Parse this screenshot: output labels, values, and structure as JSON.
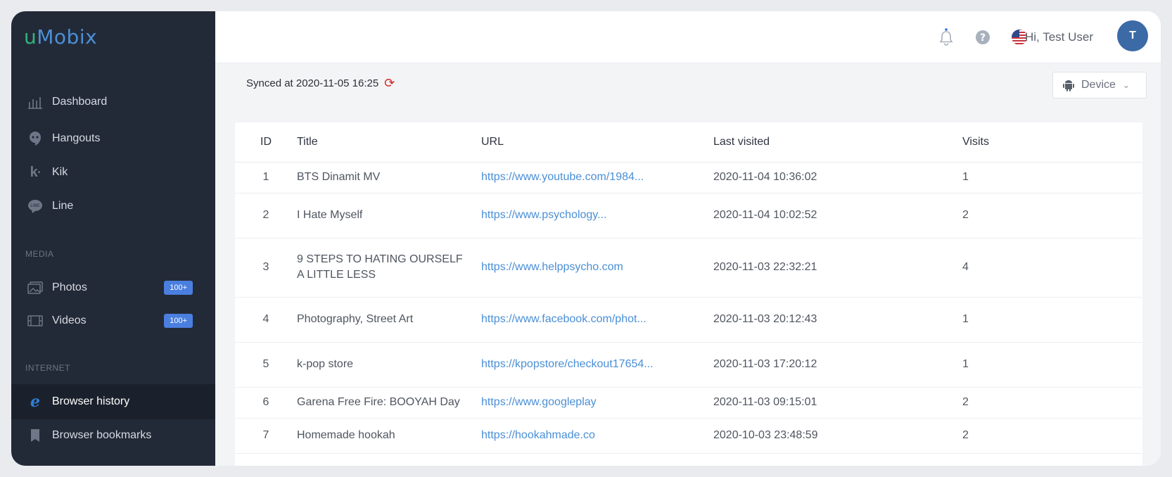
{
  "app": {
    "logo_u": "u",
    "logo_rest": "Mobix"
  },
  "sidebar": {
    "items": [
      {
        "label": "Dashboard",
        "icon": "dashboard-icon"
      },
      {
        "label": "Hangouts",
        "icon": "hangouts-icon"
      },
      {
        "label": "Kik",
        "icon": "kik-icon"
      },
      {
        "label": "Line",
        "icon": "line-icon"
      }
    ],
    "media_label": "MEDIA",
    "media": [
      {
        "label": "Photos",
        "badge": "100+",
        "icon": "photos-icon"
      },
      {
        "label": "Videos",
        "badge": "100+",
        "icon": "videos-icon"
      }
    ],
    "internet_label": "INTERNET",
    "internet": [
      {
        "label": "Browser history",
        "icon": "internet-explorer-icon",
        "active": true
      },
      {
        "label": "Browser bookmarks",
        "icon": "bookmark-icon"
      }
    ]
  },
  "topbar": {
    "greeting": "Hi, Test User",
    "avatar_initial": "T"
  },
  "sync": {
    "text": "Synced at 2020-11-05 16:25",
    "device_label": "Device"
  },
  "table": {
    "headers": {
      "id": "ID",
      "title": "Title",
      "url": "URL",
      "last": "Last visited",
      "visits": "Visits"
    },
    "rows": [
      {
        "id": "1",
        "title": "BTS Dinamit MV",
        "url": "https://www.youtube.com/1984...",
        "last": "2020-11-04 10:36:02",
        "visits": "1"
      },
      {
        "id": "2",
        "title": "I Hate Myself",
        "url": "https://www.psychology...",
        "last": "2020-11-04 10:02:52",
        "visits": "2"
      },
      {
        "id": "3",
        "title": "9 STEPS TO HATING OURSELF A LITTLE LESS",
        "url": "https://www.helppsycho.com",
        "last": "2020-11-03 22:32:21",
        "visits": "4"
      },
      {
        "id": "4",
        "title": "Photography, Street Art",
        "url": "https://www.facebook.com/phot...",
        "last": "2020-11-03 20:12:43",
        "visits": "1"
      },
      {
        "id": "5",
        "title": "k-pop store",
        "url": "https://kpopstore/checkout17654...",
        "last": "2020-11-03 17:20:12",
        "visits": "1"
      },
      {
        "id": "6",
        "title": "Garena Free Fire: BOOYAH Day",
        "url": "https://www.googleplay",
        "last": "2020-11-03 09:15:01",
        "visits": "2"
      },
      {
        "id": "7",
        "title": "Homemade hookah",
        "url": "https://hookahmade.co",
        "last": "2020-10-03 23:48:59",
        "visits": "2"
      }
    ]
  }
}
